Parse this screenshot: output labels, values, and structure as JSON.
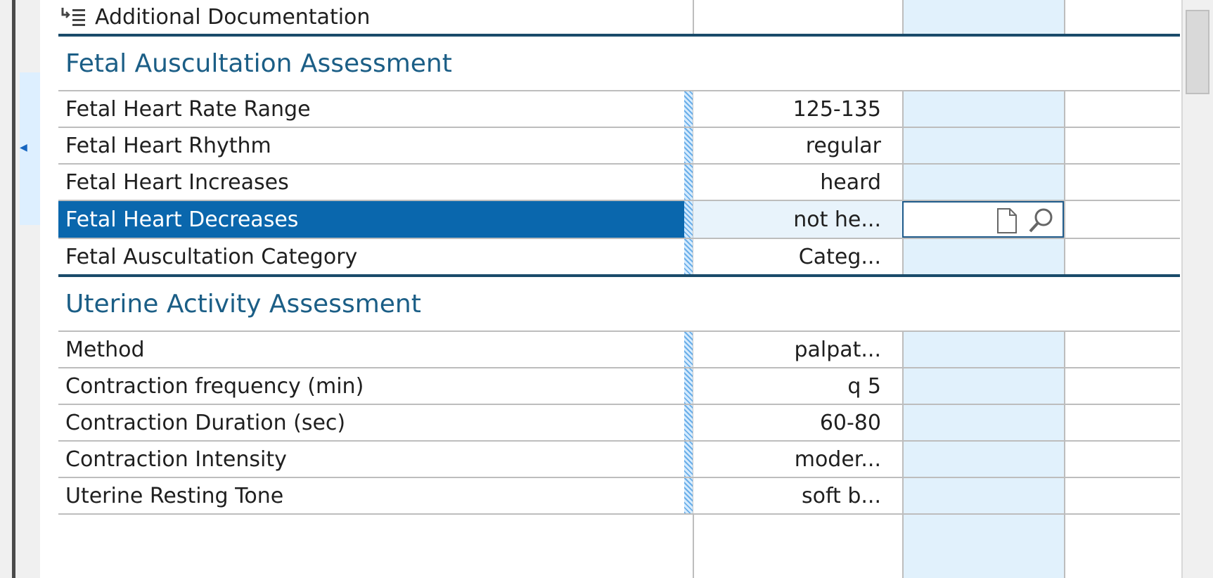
{
  "additional_documentation": {
    "label": "Additional Documentation",
    "icon": "expand-list-icon"
  },
  "sections": [
    {
      "title": "Fetal Auscultation Assessment",
      "rows": [
        {
          "label": "Fetal Heart Rate Range",
          "value": "125-135"
        },
        {
          "label": "Fetal Heart Rhythm",
          "value": "regular"
        },
        {
          "label": "Fetal Heart Increases",
          "value": "heard"
        },
        {
          "label": "Fetal Heart Decreases",
          "value": "not he...",
          "selected": true
        },
        {
          "label": "Fetal Auscultation Category",
          "value": "Categ..."
        }
      ]
    },
    {
      "title": "Uterine Activity Assessment",
      "rows": [
        {
          "label": "Method",
          "value": "palpat..."
        },
        {
          "label": "Contraction frequency (min)",
          "value": "q 5"
        },
        {
          "label": "Contraction Duration (sec)",
          "value": "60-80"
        },
        {
          "label": "Contraction Intensity",
          "value": "moder..."
        },
        {
          "label": "Uterine Resting Tone",
          "value": "soft b..."
        }
      ]
    }
  ],
  "editor": {
    "document_icon": "document-icon",
    "search_icon": "search-icon"
  },
  "colors": {
    "section_title": "#1b5e86",
    "selected_row": "#0a67ad",
    "entry_column": "#e1f1fc"
  }
}
